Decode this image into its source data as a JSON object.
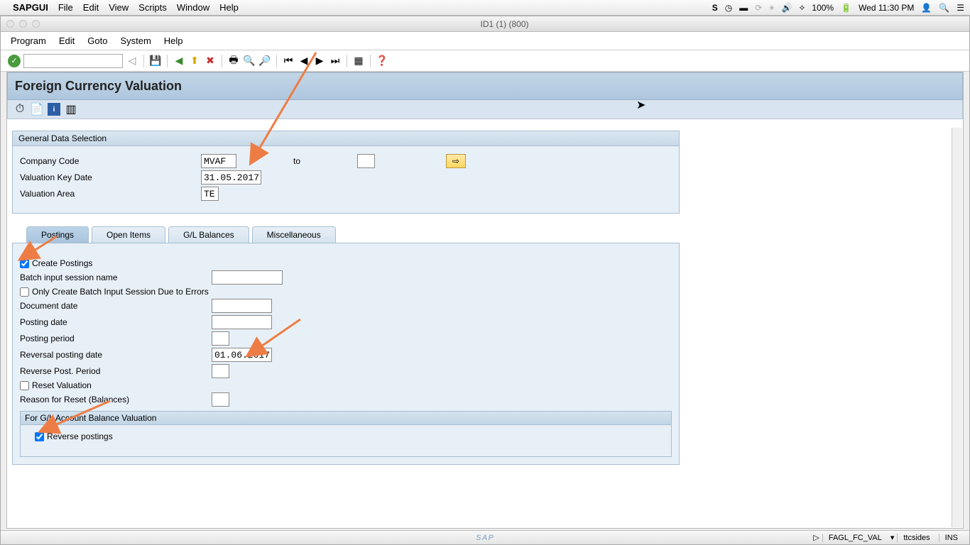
{
  "mac": {
    "app": "SAPGUI",
    "menus": [
      "File",
      "Edit",
      "View",
      "Scripts",
      "Window",
      "Help"
    ],
    "battery": "100%",
    "clock": "Wed 11:30 PM"
  },
  "window_title": "ID1 (1) (800)",
  "sap_menus": [
    "Program",
    "Edit",
    "Goto",
    "System",
    "Help"
  ],
  "page_title": "Foreign Currency Valuation",
  "general": {
    "title": "General Data Selection",
    "company_code_lbl": "Company Code",
    "company_code": "MVAF",
    "to_lbl": "to",
    "company_code_to": "",
    "key_date_lbl": "Valuation Key Date",
    "key_date": "31.05.2017",
    "area_lbl": "Valuation Area",
    "area": "TE"
  },
  "tabs": [
    "Postings",
    "Open Items",
    "G/L Balances",
    "Miscellaneous"
  ],
  "postings": {
    "create_postings_lbl": "Create Postings",
    "create_postings": true,
    "batch_name_lbl": "Batch input session name",
    "batch_name": "",
    "only_batch_lbl": "Only Create Batch Input Session Due to Errors",
    "only_batch": false,
    "doc_date_lbl": "Document date",
    "doc_date": "",
    "post_date_lbl": "Posting date",
    "post_date": "",
    "post_period_lbl": "Posting period",
    "post_period": "",
    "rev_date_lbl": "Reversal posting date",
    "rev_date": "01.06.2017",
    "rev_period_lbl": "Reverse Post. Period",
    "rev_period": "",
    "reset_val_lbl": "Reset Valuation",
    "reset_val": false,
    "reason_reset_lbl": "Reason for Reset (Balances)",
    "reason_reset": "",
    "sub_hdr": "For G/L Account Balance Valuation",
    "reverse_postings_lbl": "Reverse postings",
    "reverse_postings": true
  },
  "status": {
    "transaction": "FAGL_FC_VAL",
    "user": "ttcsides",
    "mode": "INS"
  }
}
